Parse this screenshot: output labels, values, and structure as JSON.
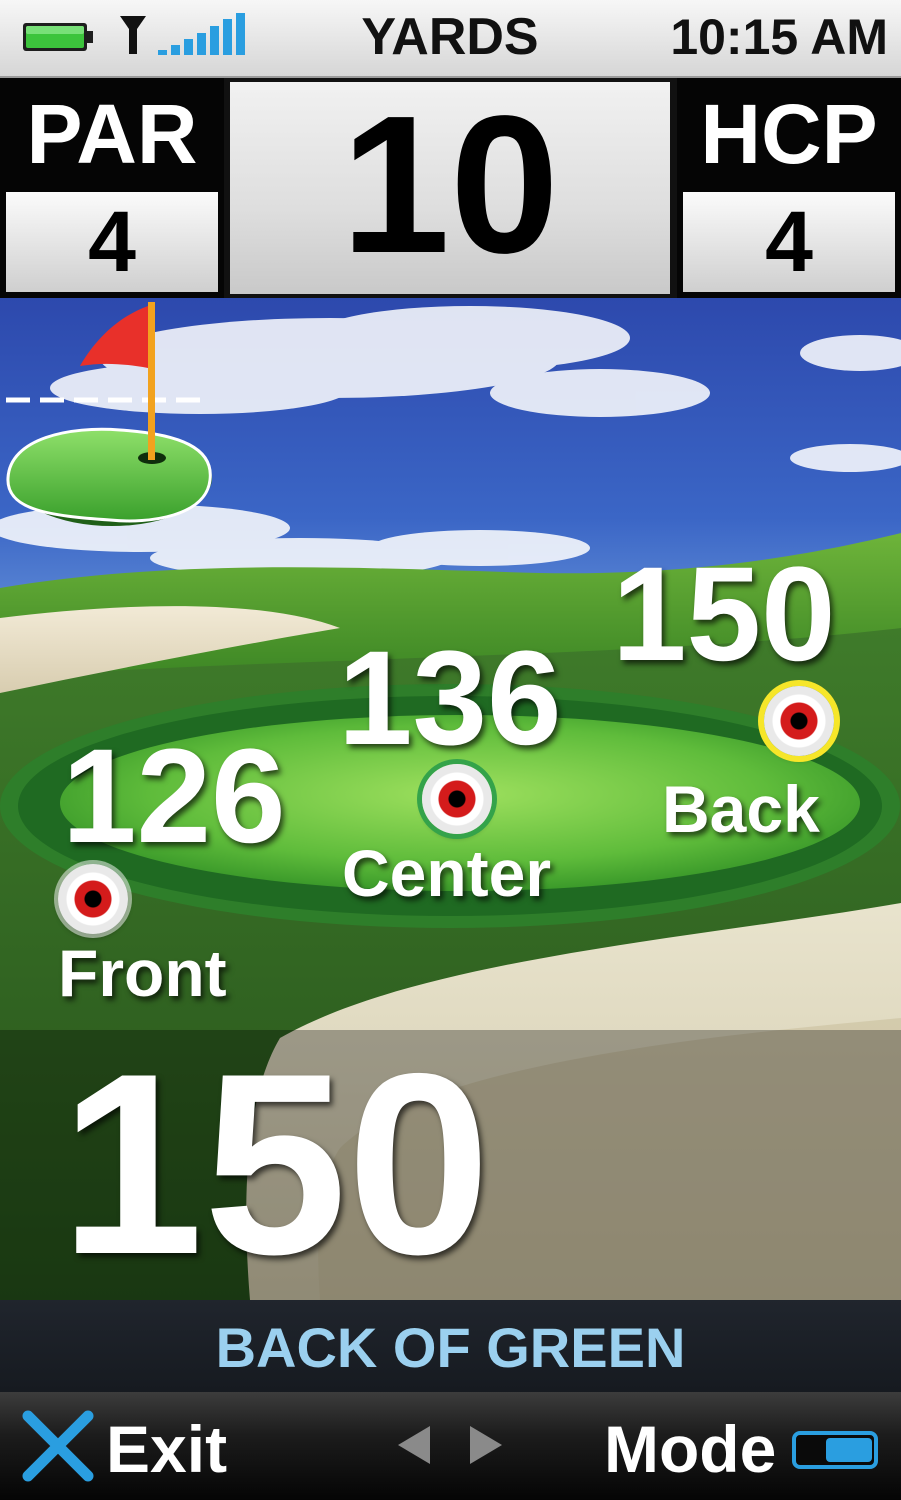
{
  "status_bar": {
    "battery_icon": "battery-full-icon",
    "signal_icon": "signal-strength-icon",
    "units": "YARDS",
    "time": "10:15 AM"
  },
  "hole_info": {
    "par_label": "PAR",
    "par_value": "4",
    "hole_number": "10",
    "hcp_label": "HCP",
    "hcp_value": "4"
  },
  "green_distances": {
    "front": {
      "distance": "126",
      "label": "Front"
    },
    "center": {
      "distance": "136",
      "label": "Center"
    },
    "back": {
      "distance": "150",
      "label": "Back"
    }
  },
  "selected": {
    "distance": "150",
    "position": "BACK OF GREEN",
    "icon": "pin-flag-on-green-icon"
  },
  "softkeys": {
    "exit_label": "Exit",
    "exit_icon": "close-x-icon",
    "prev_icon": "arrow-left-icon",
    "next_icon": "arrow-right-icon",
    "mode_label": "Mode",
    "mode_icon": "mode-toggle-icon"
  },
  "colors": {
    "position_text": "#9bd0ef",
    "accent_blue": "#2a9ee0",
    "battery_green": "#3cc43c",
    "target_red": "#d41b1b",
    "back_target_ring": "#f6e629",
    "flag_red": "#e8302a"
  }
}
